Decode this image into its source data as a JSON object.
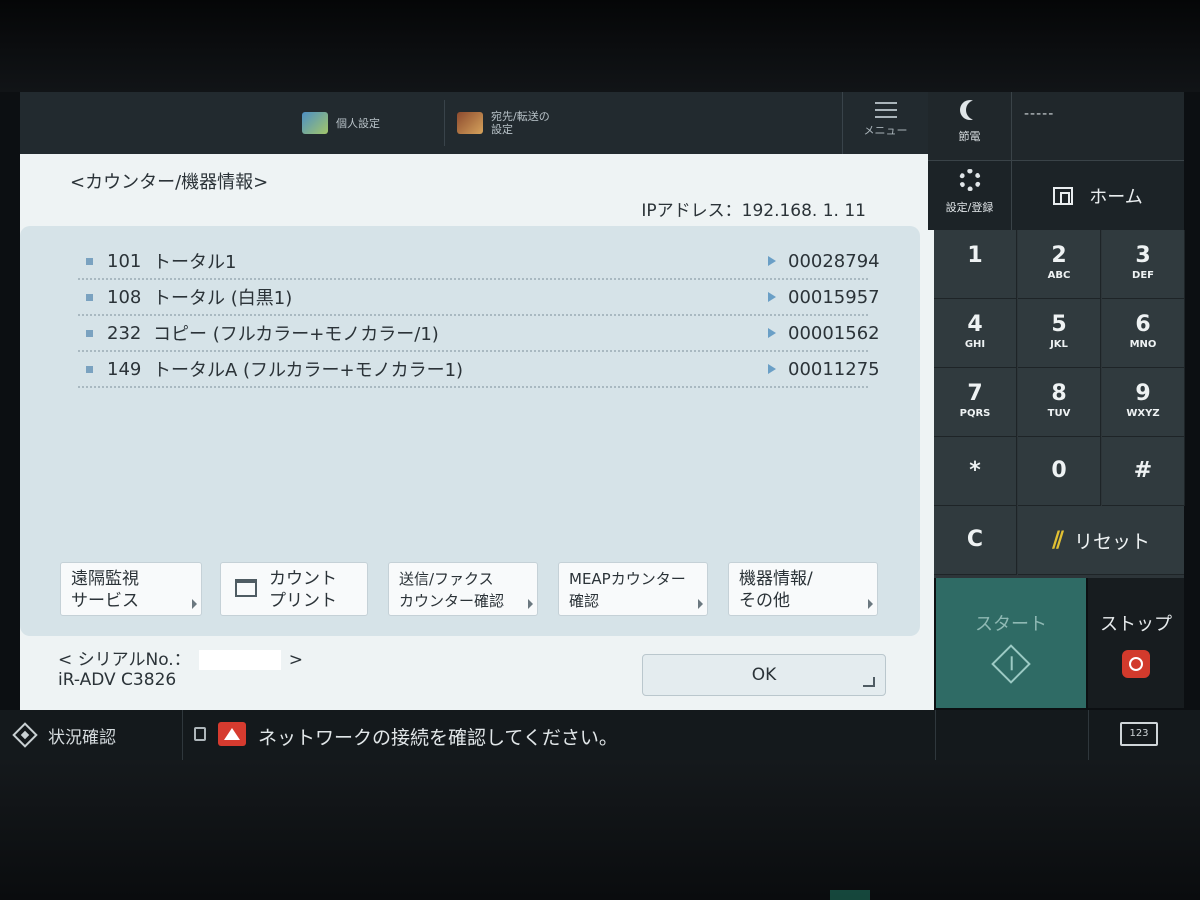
{
  "topbar": {
    "personal_settings": "個人設定",
    "dest_settings_line1": "宛先/転送の",
    "dest_settings_line2": "設定",
    "menu": "メニュー"
  },
  "main": {
    "title": "<カウンター/機器情報>",
    "ip_address": "IPアドレス：192.168. 1. 11",
    "counters": [
      {
        "code": "101",
        "label": "トータル1",
        "value": "00028794"
      },
      {
        "code": "108",
        "label": "トータル (白黒1)",
        "value": "00015957"
      },
      {
        "code": "232",
        "label": "コピー (フルカラー+モノカラー/1)",
        "value": "00001562"
      },
      {
        "code": "149",
        "label": "トータルA (フルカラー+モノカラー1)",
        "value": "00011275"
      }
    ],
    "buttons": {
      "remote_line1": "遠隔監視",
      "remote_line2": "サービス",
      "count_line1": "カウント",
      "count_line2": "プリント",
      "send_line1": "送信/ファクス",
      "send_line2": "カウンター確認",
      "meap_line1": "MEAPカウンター",
      "meap_line2": "確認",
      "device_line1": "機器情報/",
      "device_line2": "その他"
    },
    "serial_label": "< シリアルNo.：",
    "serial_close": ">",
    "model": "iR-ADV C3826",
    "ok": "OK"
  },
  "status": {
    "status_button": "状況確認",
    "message": "ネットワークの接続を確認してください。",
    "keyboard_label": "123"
  },
  "right": {
    "sleep": "節電",
    "user": "-----",
    "settings": "設定/登録",
    "home": "ホーム",
    "keys": [
      {
        "n": "1",
        "l": ""
      },
      {
        "n": "2",
        "l": "ABC"
      },
      {
        "n": "3",
        "l": "DEF"
      },
      {
        "n": "4",
        "l": "GHI"
      },
      {
        "n": "5",
        "l": "JKL"
      },
      {
        "n": "6",
        "l": "MNO"
      },
      {
        "n": "7",
        "l": "PQRS"
      },
      {
        "n": "8",
        "l": "TUV"
      },
      {
        "n": "9",
        "l": "WXYZ"
      },
      {
        "n": "*",
        "l": ""
      },
      {
        "n": "0",
        "l": ""
      },
      {
        "n": "#",
        "l": ""
      }
    ],
    "clear": "C",
    "reset": "リセット",
    "start": "スタート",
    "stop": "ストップ"
  },
  "colors": {
    "start_bg": "#2f6b65",
    "stop_icon": "#d23a2c",
    "warning": "#d63b2f",
    "reset_accent": "#e1c033"
  }
}
